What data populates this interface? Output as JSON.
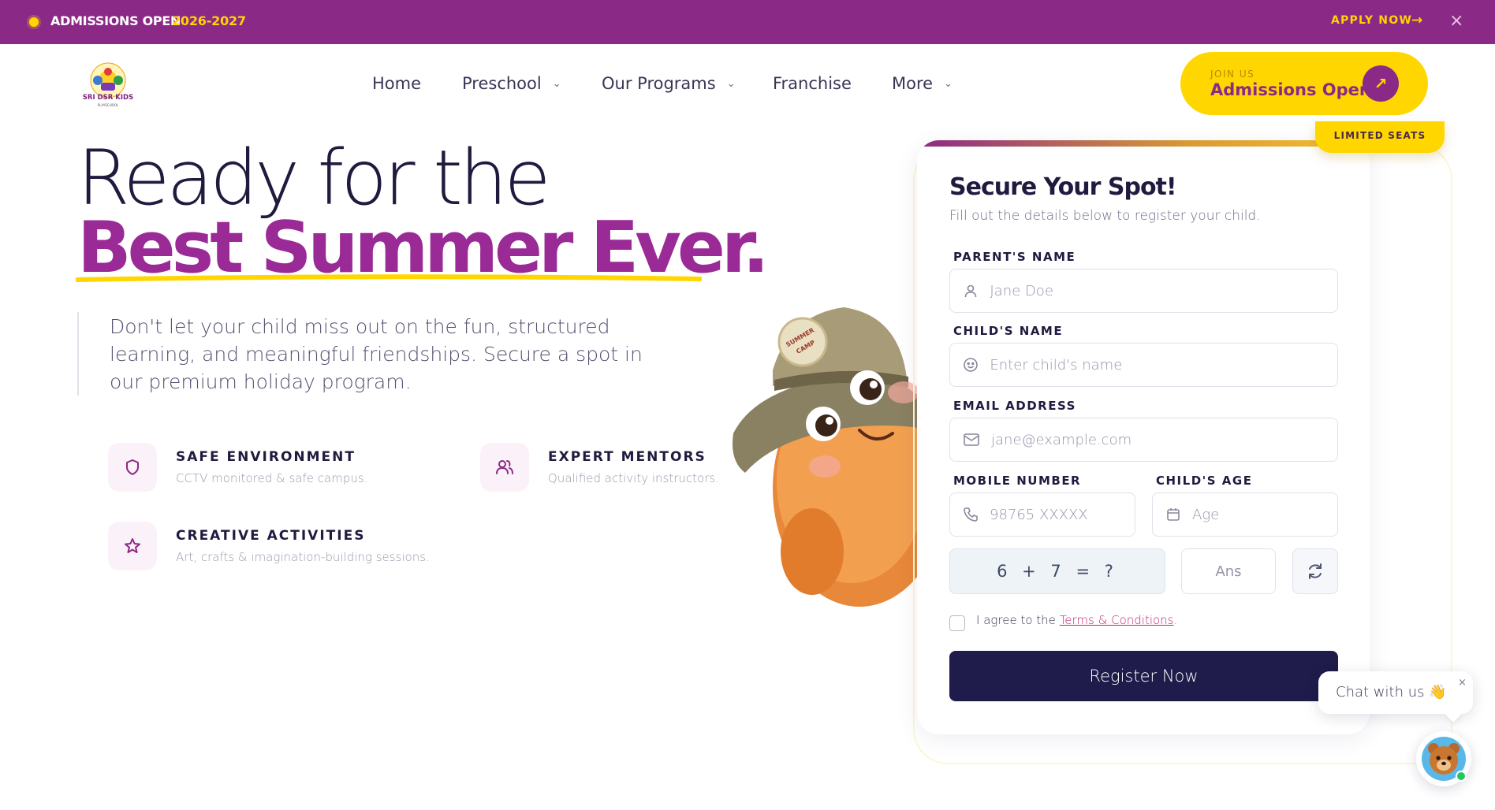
{
  "announcement": {
    "label": "ADMISSIONS OPEN",
    "year": "2026-2027",
    "apply": "APPLY NOW",
    "close_icon": "close-icon"
  },
  "nav": {
    "logo_text": "SRI DSR KIDS",
    "items": [
      {
        "label": "Home",
        "dropdown": false
      },
      {
        "label": "Preschool",
        "dropdown": true
      },
      {
        "label": "Our Programs",
        "dropdown": true
      },
      {
        "label": "Franchise",
        "dropdown": false
      },
      {
        "label": "More",
        "dropdown": true
      }
    ],
    "cta": {
      "small": "JOIN US",
      "label": "Admissions Open"
    }
  },
  "hero": {
    "title_line1": "Ready for the",
    "title_line2": "Best Summer Ever.",
    "lead": "Don't let your child miss out on the fun, structured learning, and meaningful friendships. Secure a spot in our premium holiday program.",
    "features": [
      {
        "icon": "shield-icon",
        "title": "SAFE ENVIRONMENT",
        "desc": "CCTV monitored & safe campus."
      },
      {
        "icon": "users-icon",
        "title": "EXPERT MENTORS",
        "desc": "Qualified activity instructors."
      },
      {
        "icon": "star-icon",
        "title": "CREATIVE ACTIVITIES",
        "desc": "Art, crafts & imagination-building sessions."
      }
    ],
    "mascot_hat_text": "SUMMER CAMP"
  },
  "form": {
    "badge": "LIMITED SEATS",
    "title": "Secure Your Spot!",
    "subtitle": "Fill out the details below to register your child.",
    "parent_label": "PARENT'S NAME",
    "parent_placeholder": "Jane Doe",
    "child_label": "CHILD'S NAME",
    "child_placeholder": "Enter child's name",
    "email_label": "EMAIL ADDRESS",
    "email_placeholder": "jane@example.com",
    "mobile_label": "MOBILE NUMBER",
    "mobile_placeholder": "98765 XXXXX",
    "age_label": "CHILD'S AGE",
    "age_placeholder": "Age",
    "captcha": "6 + 7 = ?",
    "answer_placeholder": "Ans",
    "agree_prefix": "I agree to the",
    "terms_link": "Terms & Conditions",
    "agree_suffix": ".",
    "submit": "Register Now"
  },
  "chat": {
    "label": "Chat with us 👋",
    "close": "×"
  },
  "colors": {
    "brand_purple": "#8b2a86",
    "brand_yellow": "#ffd600",
    "navy": "#1f1b4a",
    "link_pink": "#c2266f"
  }
}
